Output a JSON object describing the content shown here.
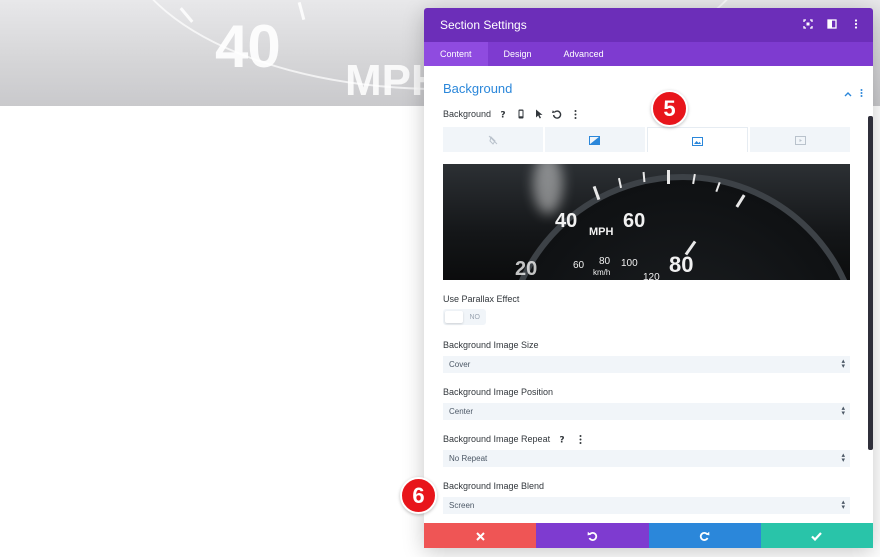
{
  "background_preview": {
    "speed_number": "40",
    "speed_unit": "MPH"
  },
  "modal": {
    "title": "Section Settings",
    "header_colors": {
      "header": "#6c2eb9",
      "tabs": "#7e3bd0",
      "active_tab": "#8f4be0"
    },
    "header_icons": [
      "fullscreen-icon",
      "split-layout-icon",
      "more-vertical-icon"
    ],
    "tabs": [
      {
        "label": "Content",
        "active": true
      },
      {
        "label": "Design",
        "active": false
      },
      {
        "label": "Advanced",
        "active": false
      }
    ]
  },
  "background_section": {
    "title": "Background",
    "field_label": "Background",
    "label_icons": [
      "help-icon",
      "mobile-icon",
      "cursor-icon",
      "reset-icon",
      "more-vertical-icon"
    ],
    "type_tabs": [
      {
        "icon": "no-background-icon",
        "active": false
      },
      {
        "icon": "gradient-icon",
        "active": false
      },
      {
        "icon": "image-icon",
        "active": true
      },
      {
        "icon": "video-icon",
        "active": false
      }
    ],
    "image_preview": {
      "numbers": {
        "n40": "40",
        "n60": "60",
        "n80": "80",
        "n20": "20",
        "s60": "60",
        "s80": "80",
        "s100": "100",
        "s120": "120"
      },
      "units": {
        "mph": "MPH",
        "kmh": "km/h"
      }
    },
    "parallax": {
      "label": "Use Parallax Effect",
      "value": "NO"
    },
    "image_size": {
      "label": "Background Image Size",
      "value": "Cover"
    },
    "image_position": {
      "label": "Background Image Position",
      "value": "Center"
    },
    "image_repeat": {
      "label": "Background Image Repeat",
      "value": "No Repeat"
    },
    "image_blend": {
      "label": "Background Image Blend",
      "value": "Screen"
    }
  },
  "footer_buttons": [
    {
      "name": "discard",
      "icon": "close-icon",
      "color": "#ef5555"
    },
    {
      "name": "undo",
      "icon": "undo-icon",
      "color": "#7e3bd0"
    },
    {
      "name": "redo",
      "icon": "redo-icon",
      "color": "#2b87da"
    },
    {
      "name": "save",
      "icon": "check-icon",
      "color": "#29c4a9"
    }
  ],
  "annotations": {
    "step5": "5",
    "step6": "6"
  }
}
